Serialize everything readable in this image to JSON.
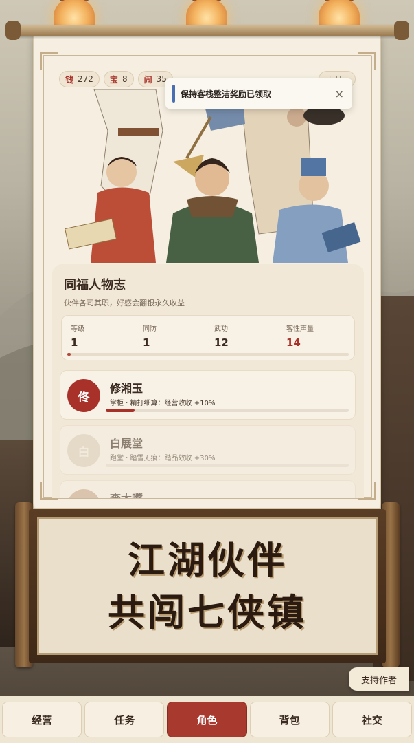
{
  "resources": [
    {
      "label": "钱",
      "value": "272"
    },
    {
      "label": "宝",
      "value": "8"
    },
    {
      "label": "闹",
      "value": "35"
    }
  ],
  "rank_chip": "上品",
  "toast": {
    "message": "保持客栈整洁奖励已领取",
    "close": "×"
  },
  "card": {
    "title": "同福人物志",
    "subtitle": "伙伴各司其职，好感会翻银永久收益",
    "stats": [
      {
        "label": "等级",
        "value": "1"
      },
      {
        "label": "同防",
        "value": "1"
      },
      {
        "label": "武功",
        "value": "12"
      },
      {
        "label": "客性声量",
        "value": "14"
      }
    ],
    "stats_progress": 0.01,
    "companions": [
      {
        "avatar": "佟",
        "name": "修湘玉",
        "desc": "掌柜 · 精打细算：经营收收 +10%",
        "progress": 0.12,
        "locked": false,
        "color": "#a8322a"
      },
      {
        "avatar": "白",
        "name": "白展堂",
        "desc": "跑堂 · 踏雪无痕：踏品效收 +30%",
        "progress": 0,
        "locked": true,
        "color": "#ddd0bc"
      },
      {
        "avatar": "",
        "name": "李大嘴",
        "desc": "",
        "progress": 0,
        "locked": true,
        "color": "#c9a88a"
      }
    ]
  },
  "banner": {
    "line1": "江湖伙伴",
    "line2": "共闯七侠镇"
  },
  "support_button": "支持作者",
  "nav": [
    {
      "label": "经营",
      "active": false
    },
    {
      "label": "任务",
      "active": false
    },
    {
      "label": "角色",
      "active": true
    },
    {
      "label": "背包",
      "active": false
    },
    {
      "label": "社交",
      "active": false
    }
  ]
}
